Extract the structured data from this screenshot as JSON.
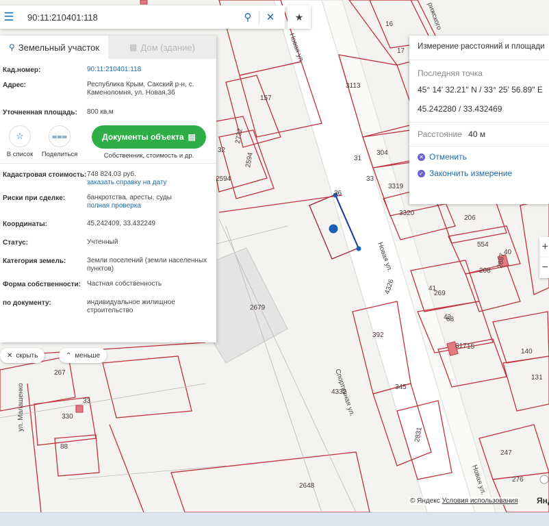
{
  "search": {
    "value": "90:11:210401:118",
    "menu_icon": "menu-icon",
    "search_icon": "search-icon",
    "clear_icon": "close-icon",
    "favorite_icon": "star-icon"
  },
  "panel": {
    "tab_active": "Земельный участок",
    "tab_inactive": "Дом (здание)",
    "fields": [
      {
        "label": "Кад.номер:",
        "value": "90:11:210401:118",
        "link": true
      },
      {
        "label": "Адрес:",
        "value": "Республика Крым, Сакский р-н, с. Каменоломня, ул. Новая,36"
      },
      {
        "label": "Уточненная площадь:",
        "value": "800 кв.м"
      }
    ],
    "actions": {
      "add_list": "В список",
      "share": "Поделиться",
      "documents_button": "Документы объекта",
      "documents_sub": "Собственник, стоимость и др."
    },
    "details": [
      {
        "label": "Кадастровая стоимость:",
        "value": "748 824.03 руб.",
        "link_text": "заказать справку на дату"
      },
      {
        "label": "Риски при сделке:",
        "value": "банкротства, аресты, суды",
        "link_text": "полная проверка"
      },
      {
        "label": "Координаты:",
        "value": "45.242409, 33.432249"
      },
      {
        "label": "Статус:",
        "value": "Учтенный"
      },
      {
        "label": "Категория земель:",
        "value": "Земли поселений (земли населенных пунктов)"
      },
      {
        "label": "Форма собственности:",
        "value": "Частная собственность"
      },
      {
        "label": "по документу:",
        "value": "индивидуальное жилищное строительство"
      }
    ],
    "hide_label": "скрыть",
    "less_label": "меньше"
  },
  "measure": {
    "title": "Измерение расстояний и площади",
    "last_point_label": "Последняя точка",
    "dms": "45° 14' 32.21\" N / 33° 25' 56.89\" E",
    "decimal": "45.242280 / 33.432469",
    "distance_label": "Расстояние",
    "distance_value": "40 м",
    "cancel": "Отменить",
    "finish": "Закончить измерение"
  },
  "map": {
    "plot_labels": [
      "16",
      "17",
      "3113",
      "157",
      "2732",
      "32",
      "2594",
      "2594",
      "304",
      "31",
      "33",
      "3319",
      "3320",
      "206",
      "554",
      "40",
      "2887",
      "208",
      "41",
      "269",
      "42",
      "68",
      "817",
      "15",
      "392",
      "140",
      "131",
      "345",
      "2831",
      "247",
      "276",
      "2679",
      "2648",
      "267",
      "330",
      "33",
      "88",
      "36",
      "4326",
      "4332"
    ],
    "street_labels": [
      "Новая ул.",
      "Новая ул.",
      "Спортивная ул.",
      "Новая ул.",
      "ул. Малашенко",
      "рижского"
    ],
    "measure_line_color": "#1a3f9c",
    "boundary_color": "#c0323c"
  },
  "attribution": {
    "prefix": "© Яндекс",
    "terms": "Условия использования",
    "logo": "Янде"
  }
}
